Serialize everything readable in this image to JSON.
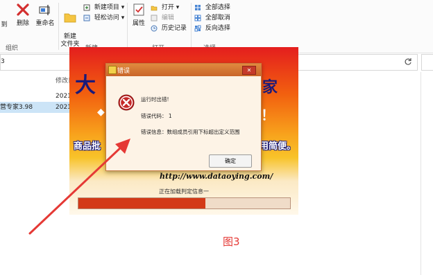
{
  "ribbon": {
    "delete_fragment": "到",
    "delete_label": "删除",
    "rename_label": "重命名",
    "new_folder_label": "新建\n文件夹",
    "new_item_label": "新建项目",
    "easy_access_label": "轻松访问",
    "properties_label": "属性",
    "open_label": "打开",
    "edit_label": "编辑",
    "history_label": "历史记录",
    "select_all_label": "全部选择",
    "select_none_label": "全部取消",
    "invert_label": "反向选择",
    "groups": {
      "organize": "组织",
      "new": "新建",
      "open": "打开",
      "select": "选择"
    }
  },
  "address": {
    "fragment": "3"
  },
  "list": {
    "modified_header": "修改日",
    "rows": [
      {
        "name": "",
        "date": "2021"
      },
      {
        "name": "营专家3.98",
        "date": "2021"
      }
    ]
  },
  "splash": {
    "big_char": "大",
    "right_char": "家",
    "exclaim": "！",
    "left_slogan": "商品批",
    "right_slogan": "用简便。",
    "url": "http://www.dataoying.com/",
    "loading_text": "正在加载判定信息一",
    "progress": 0.6
  },
  "dialog": {
    "title": "错误",
    "close": "✕",
    "line1": "运行时出错!",
    "line2": "错误代码： 1",
    "line3": "错误信息：数组成员引用下标超出定义范围",
    "ok_label": "确定"
  },
  "figure_label": "图3",
  "colors": {
    "arrow": "#e53935",
    "error": "#c62828"
  }
}
